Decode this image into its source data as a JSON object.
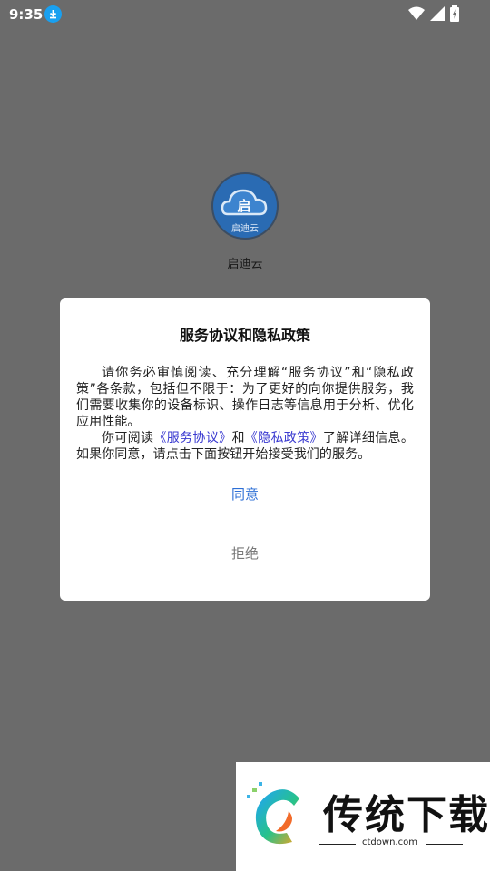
{
  "status_bar": {
    "time": "9:35"
  },
  "app": {
    "name": "启迪云",
    "logo_text": "启迪云"
  },
  "dialog": {
    "title": "服务协议和隐私政策",
    "paragraph1": "请你务必审慎阅读、充分理解“服务协议”和“隐私政策”各条款，包括但不限于：为了更好的向你提供服务，我们需要收集你的设备标识、操作日志等信息用于分析、优化应用性能。",
    "p2_before": "你可阅读",
    "link_service": "《服务协议》",
    "p2_and": "和",
    "link_privacy": "《隐私政策》",
    "p2_after": "了解详细信息。如果你同意，请点击下面按钮开始接受我们的服务。",
    "agree_label": "同意",
    "refuse_label": "拒绝"
  },
  "watermark": {
    "title": "传统下载",
    "url": "ctdown.com"
  },
  "colors": {
    "dim_overlay": "#6b6b6b",
    "agree": "#2d6fd6",
    "link": "#3a3ad0",
    "download_badge": "#19a0f0"
  }
}
